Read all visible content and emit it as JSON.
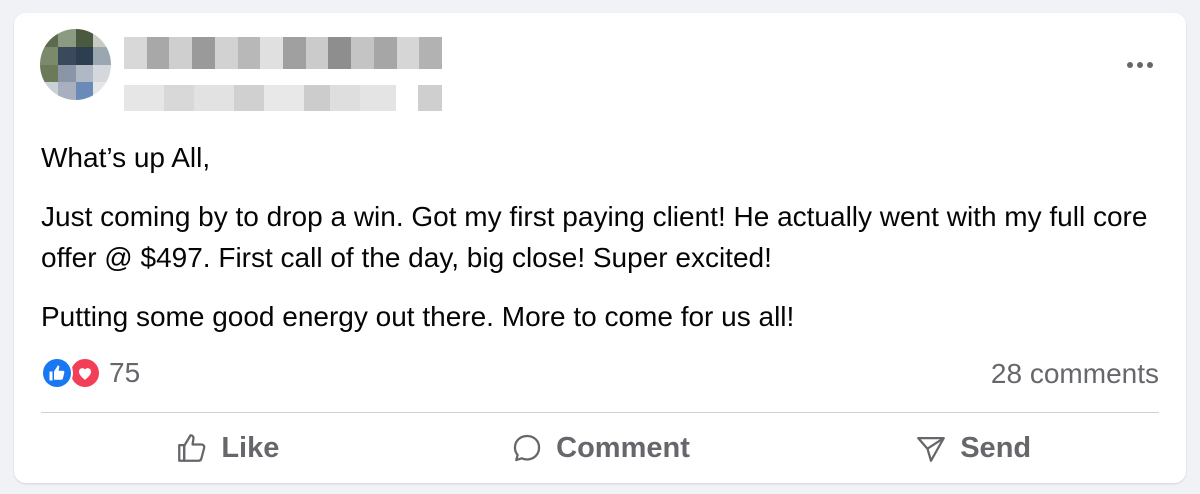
{
  "post": {
    "author_name": "",
    "timestamp": "",
    "paragraphs": [
      "What’s up All,",
      "Just coming by to drop a win. Got my first paying client! He actually went with my full core offer @ $497. First call of the day, big close! Super excited!",
      "Putting some good energy out there. More to come for us all!"
    ]
  },
  "stats": {
    "reaction_count": "75",
    "comments_label": "28 comments",
    "reactions": [
      "like-icon",
      "love-icon"
    ]
  },
  "actions": {
    "like_label": "Like",
    "comment_label": "Comment",
    "send_label": "Send"
  },
  "colors": {
    "like_blue": "#1877f2",
    "love_red": "#f33e58",
    "secondary_text": "#65676b",
    "background": "#f0f2f5"
  }
}
